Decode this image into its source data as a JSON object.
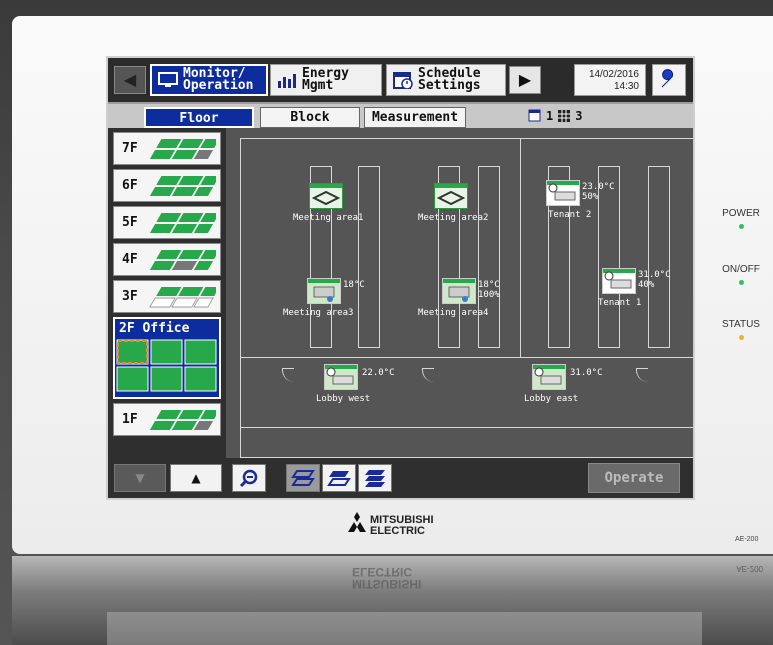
{
  "device": {
    "brand_line1": "MITSUBISHI",
    "brand_line2": "ELECTRIC",
    "model": "AE-200",
    "leds": [
      {
        "label": "POWER",
        "color": "#2fbf6a"
      },
      {
        "label": "ON/OFF",
        "color": "#2fbf6a"
      },
      {
        "label": "STATUS",
        "color": "#f0b020"
      }
    ]
  },
  "nav": {
    "tabs": [
      {
        "label": "Monitor/\nOperation",
        "icon": "monitor-icon",
        "active": true
      },
      {
        "label": "Energy\nMgmt",
        "icon": "bar-chart-icon",
        "active": false
      },
      {
        "label": "Schedule\nSettings",
        "icon": "calendar-icon",
        "active": false
      }
    ],
    "date": "14/02/2016",
    "time": "14:30",
    "settings_icon": "wrench-icon"
  },
  "subtabs": [
    {
      "label": "Floor",
      "active": true
    },
    {
      "label": "Block",
      "active": false
    },
    {
      "label": "Measurement",
      "active": false
    }
  ],
  "counts": {
    "schedule_count": "1",
    "grid_count": "3"
  },
  "floors": [
    {
      "label": "7F"
    },
    {
      "label": "6F"
    },
    {
      "label": "5F"
    },
    {
      "label": "4F"
    },
    {
      "label": "3F"
    },
    {
      "label": "2F Office",
      "active": true
    },
    {
      "label": "1F"
    }
  ],
  "map": {
    "units": [
      {
        "name": "Meeting area1",
        "temp": "",
        "type": "vent"
      },
      {
        "name": "Meeting area2",
        "temp": "",
        "type": "vent"
      },
      {
        "name": "Tenant 2",
        "temp": "23.0°C",
        "humidity": "50%",
        "type": "ac"
      },
      {
        "name": "Meeting area3",
        "temp": "18°C",
        "type": "ac"
      },
      {
        "name": "Meeting area4",
        "temp": "18°C",
        "humidity": "100%",
        "type": "ac"
      },
      {
        "name": "Tenant 1",
        "temp": "31.0°C",
        "humidity": "40%",
        "type": "ac"
      },
      {
        "name": "Lobby west",
        "temp": "22.0°C",
        "type": "ac"
      },
      {
        "name": "Lobby east",
        "temp": "31.0°C",
        "type": "ac"
      }
    ]
  },
  "bottom": {
    "operate_label": "Operate"
  },
  "colors": {
    "active_tab": "#0d2d9e",
    "floor_green": "#27a84a",
    "map_bg": "#555555"
  }
}
